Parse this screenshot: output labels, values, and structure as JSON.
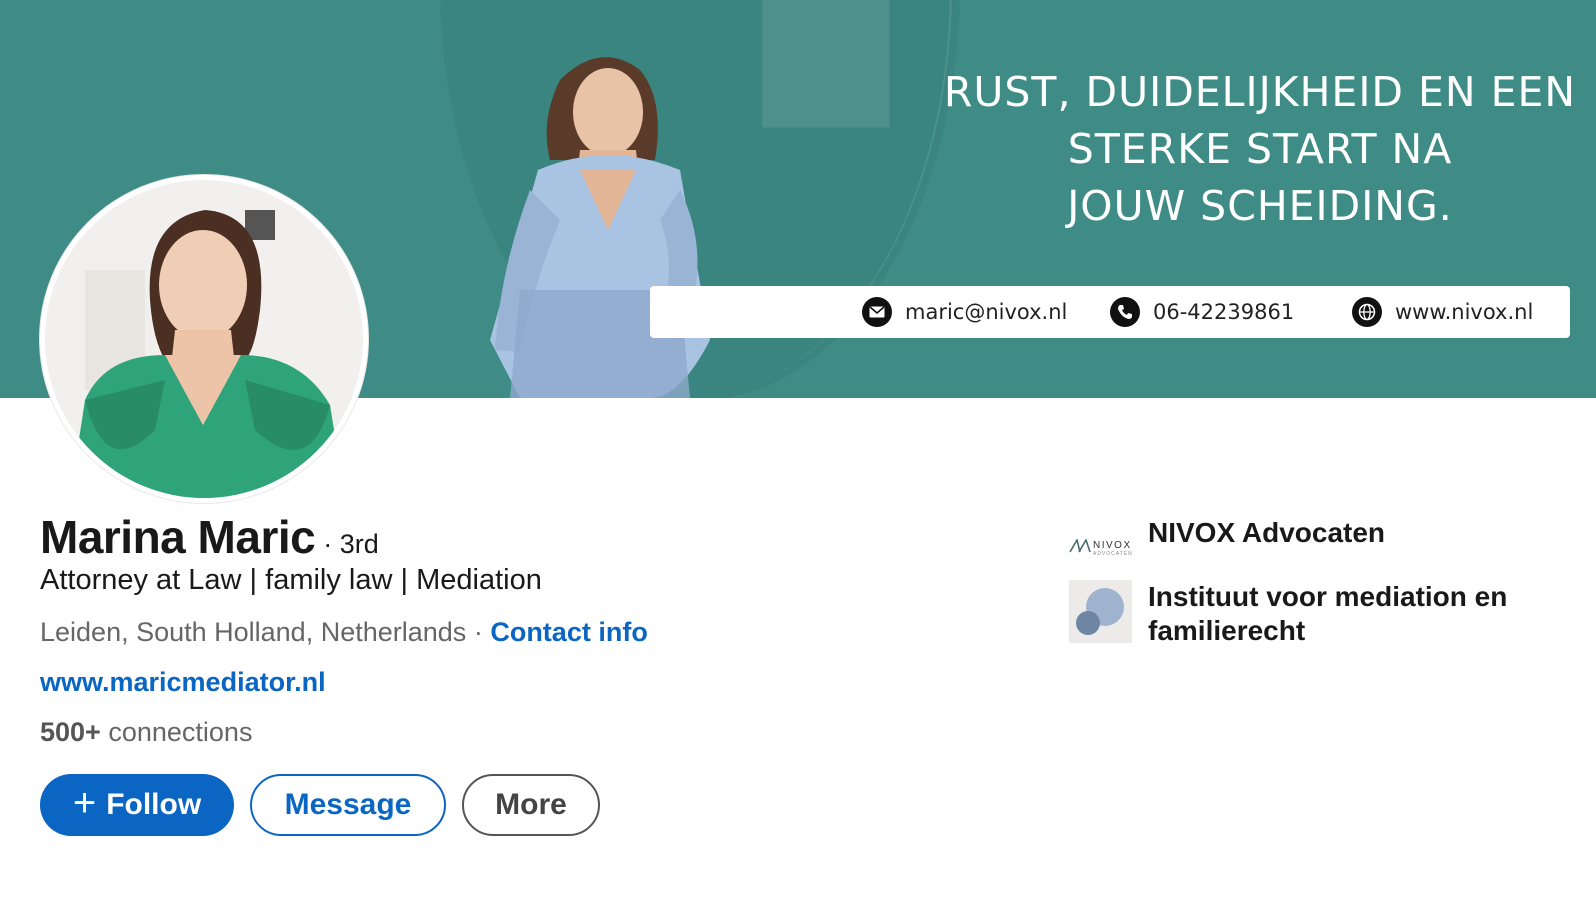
{
  "banner": {
    "tagline": [
      "RUST, DUIDELIJKHEID EN EEN",
      "STERKE START NA",
      "JOUW SCHEIDING."
    ],
    "email": "maric@nivox.nl",
    "phone": "06-42239861",
    "website": "www.nivox.nl",
    "background_color": "#3f8c86"
  },
  "profile": {
    "name": "Marina Maric",
    "degree": "· 3rd",
    "headline": "Attorney at Law | family law | Mediation",
    "location": "Leiden, South Holland, Netherlands",
    "separator": "·",
    "contact_info_label": "Contact info",
    "website": "www.maricmediator.nl",
    "connections_count": "500+",
    "connections_label": "connections"
  },
  "actions": {
    "follow_icon": "+",
    "follow_label": "Follow",
    "message_label": "Message",
    "more_label": "More"
  },
  "organizations": [
    {
      "name": "NIVOX Advocaten",
      "logo_text": "NIVOX",
      "logo_subtext": "ADVOCATEN",
      "logo_icon": "nivox-logo-icon"
    },
    {
      "name": "Instituut voor mediation en familierecht",
      "logo_icon": "circles-logo-icon"
    }
  ],
  "colors": {
    "accent": "#0a66c2",
    "banner_teal": "#3f8c86",
    "avatar_shirt": "#2fa37a"
  }
}
